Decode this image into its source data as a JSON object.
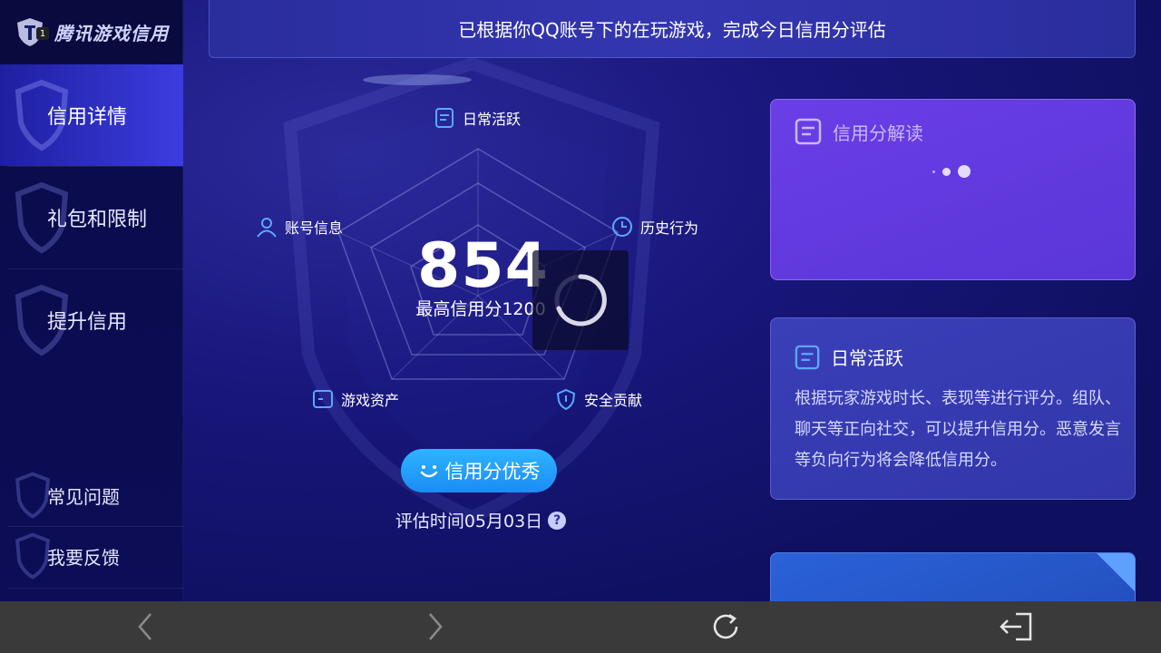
{
  "app": {
    "logo_text": "腾讯游戏信用",
    "logo_badge": "1"
  },
  "sidebar": {
    "items": [
      {
        "label": "信用详情",
        "active": true
      },
      {
        "label": "礼包和限制",
        "active": false
      },
      {
        "label": "提升信用",
        "active": false
      }
    ],
    "footer_items": [
      {
        "label": "常见问题"
      },
      {
        "label": "我要反馈"
      }
    ]
  },
  "banner": {
    "text": "已根据你QQ账号下的在玩游戏，完成今日信用分评估"
  },
  "radar": {
    "axes": [
      {
        "label": "日常活跃",
        "icon": "doc-icon"
      },
      {
        "label": "历史行为",
        "icon": "clock-icon"
      },
      {
        "label": "安全贡献",
        "icon": "shield-icon"
      },
      {
        "label": "游戏资产",
        "icon": "wallet-icon"
      },
      {
        "label": "账号信息",
        "icon": "user-icon"
      }
    ],
    "score": "854",
    "max_label": "最高信用分1200",
    "grade_label": "信用分优秀",
    "eval_time": "评估时间05月03日",
    "help": "?"
  },
  "cards": {
    "interpretation": {
      "title": "信用分解读",
      "icon": "doc-icon"
    },
    "detail": {
      "title": "日常活跃",
      "icon": "doc-icon",
      "text": "根据玩家游戏时长、表现等进行评分。组队、聊天等正向社交，可以提升信用分。恶意发言等负向行为将会降低信用分。"
    }
  },
  "bottom_bar": {
    "buttons": [
      "back-icon",
      "forward-icon",
      "refresh-icon",
      "exit-icon"
    ]
  },
  "colors": {
    "accent_blue": "#1a8cf5",
    "card_purple": "#5a36d8",
    "background": "#18167a"
  }
}
